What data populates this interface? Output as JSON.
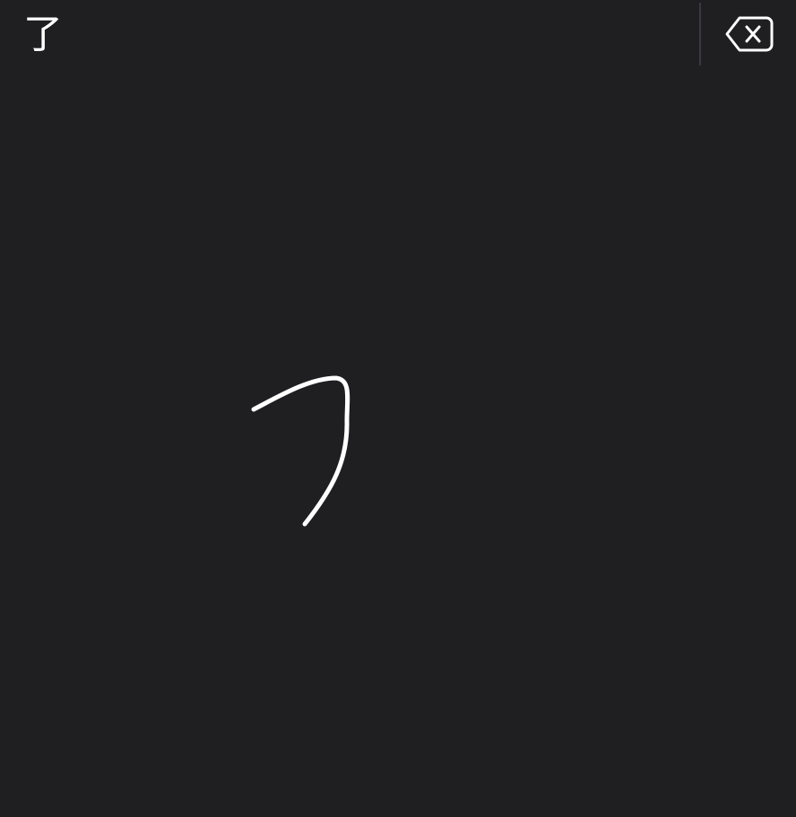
{
  "candidates": {
    "items": [
      "了"
    ]
  },
  "colors": {
    "background": "#1f1e21",
    "ink": "#ffffff",
    "divider": "#3a393d"
  },
  "icons": {
    "backspace": "backspace-icon"
  },
  "stroke": {
    "shape": "handwritten-stroke"
  }
}
